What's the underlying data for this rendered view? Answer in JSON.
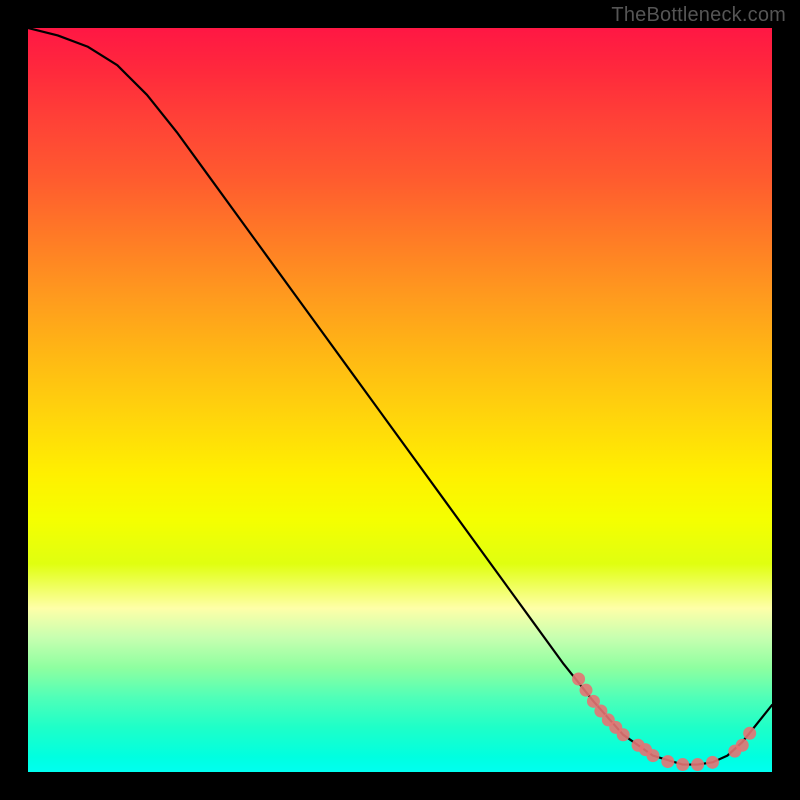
{
  "watermark": "TheBottleneck.com",
  "chart_data": {
    "type": "line",
    "title": "",
    "xlabel": "",
    "ylabel": "",
    "xlim": [
      0,
      100
    ],
    "ylim": [
      0,
      100
    ],
    "grid": false,
    "legend": false,
    "series": [
      {
        "name": "curve",
        "style": "line",
        "color": "#000000",
        "x": [
          0,
          4,
          8,
          12,
          16,
          20,
          24,
          28,
          32,
          36,
          40,
          44,
          48,
          52,
          56,
          60,
          64,
          68,
          72,
          76,
          80,
          84,
          88,
          90,
          92,
          94,
          96,
          100
        ],
        "y": [
          100,
          99,
          97.5,
          95,
          91,
          86,
          80.5,
          75,
          69.5,
          64,
          58.5,
          53,
          47.5,
          42,
          36.5,
          31,
          25.5,
          20,
          14.5,
          9.5,
          5,
          2.2,
          1,
          1,
          1.3,
          2.2,
          4,
          9
        ]
      },
      {
        "name": "segment-dots",
        "style": "scatter",
        "color": "#e57373",
        "x": [
          74,
          75,
          76,
          77,
          78,
          79,
          80,
          82,
          83,
          84,
          86,
          88,
          90,
          92,
          95,
          96,
          97
        ],
        "y": [
          12.5,
          11,
          9.5,
          8.2,
          7,
          6,
          5,
          3.6,
          3,
          2.2,
          1.4,
          1,
          1,
          1.3,
          2.8,
          3.6,
          5.2
        ]
      }
    ]
  }
}
